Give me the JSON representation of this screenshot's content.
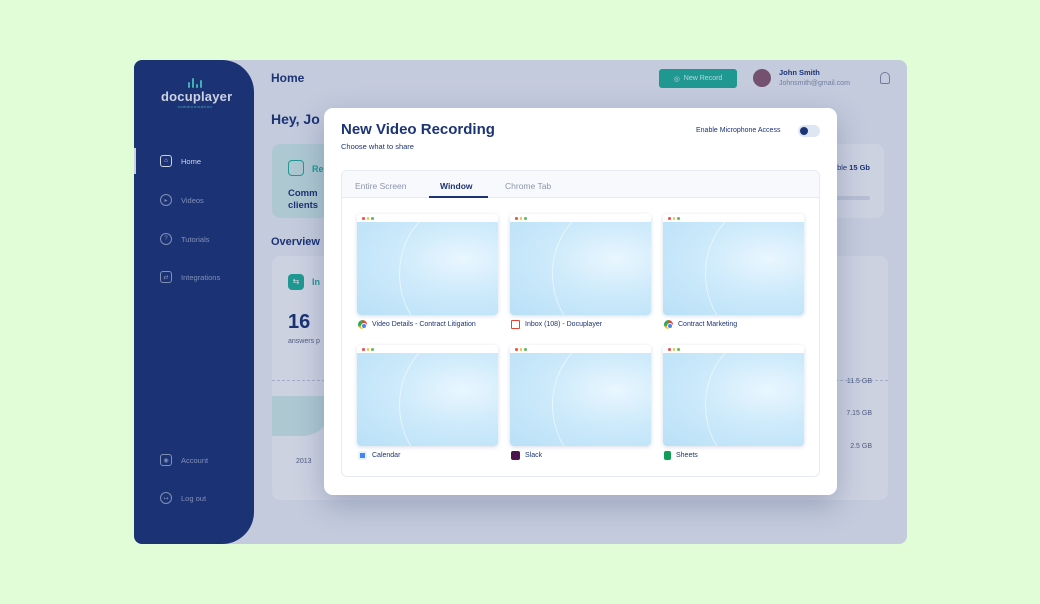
{
  "sidebar": {
    "logo": {
      "name": "docuplayer",
      "tagline": "communication"
    },
    "items": [
      {
        "label": "Home",
        "icon": "home-icon"
      },
      {
        "label": "Videos",
        "icon": "play-icon"
      },
      {
        "label": "Tutorials",
        "icon": "tutorial-icon"
      },
      {
        "label": "Integrations",
        "icon": "integrations-icon"
      }
    ],
    "bottom_items": [
      {
        "label": "Account",
        "icon": "account-icon"
      },
      {
        "label": "Log out",
        "icon": "logout-icon"
      }
    ]
  },
  "header": {
    "title": "Home",
    "new_record_label": "New Record",
    "user": {
      "name": "John Smith",
      "email": "Johnsmith@gmail.com"
    }
  },
  "background": {
    "greeting": "Hey, Jo",
    "card_text": "Comm clients",
    "card_title_partial": "Re",
    "storage_prefix": "ble ",
    "storage_value": "15 Gb",
    "overview_title": "Overview",
    "overview_card_title_partial": "In",
    "stat_number": "16",
    "stat_sub": "answers p",
    "sizes": [
      "11.5 GB",
      "7.15 GB",
      "2.5 GB"
    ],
    "year": "2013"
  },
  "modal": {
    "title": "New Video Recording",
    "subtitle": "Choose what to share",
    "mic_label": "Enable Microphone Access",
    "mic_enabled": true,
    "tabs": [
      {
        "label": "Entire Screen",
        "active": false
      },
      {
        "label": "Window",
        "active": true
      },
      {
        "label": "Chrome Tab",
        "active": false
      }
    ],
    "windows": [
      {
        "label": "Video Details - Contract Litigation",
        "icon": "chrome-icon"
      },
      {
        "label": "Inbox (108) - Docuplayer",
        "icon": "gmail-icon"
      },
      {
        "label": "Contract Marketing",
        "icon": "chrome-icon"
      },
      {
        "label": "Calendar",
        "icon": "google-calendar-icon"
      },
      {
        "label": "Slack",
        "icon": "slack-icon"
      },
      {
        "label": "Sheets",
        "icon": "google-sheets-icon"
      }
    ]
  },
  "colors": {
    "page_bg": "#e1fdd8",
    "sidebar": "#1c3475",
    "accent": "#22b59a",
    "text_primary": "#1c3475"
  }
}
